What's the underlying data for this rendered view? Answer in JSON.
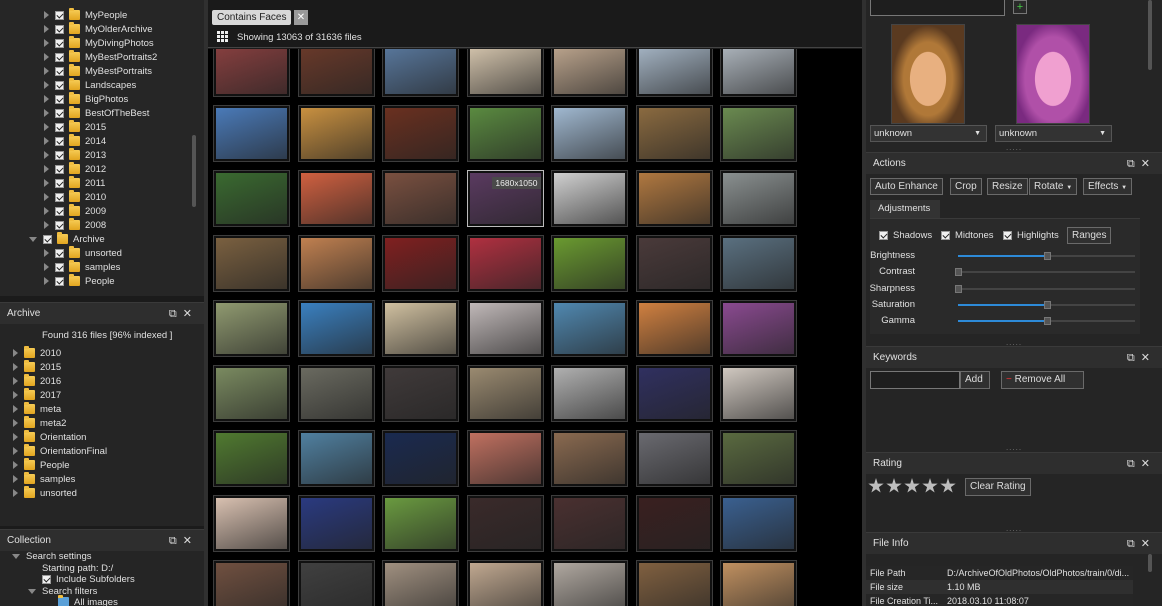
{
  "folders_top": {
    "items": [
      {
        "label": "MyPeople",
        "level": 2,
        "checked": true,
        "expander": "closed"
      },
      {
        "label": "MyOlderArchive",
        "level": 2,
        "checked": true,
        "expander": "closed"
      },
      {
        "label": "MyDivingPhotos",
        "level": 2,
        "checked": true,
        "expander": "closed"
      },
      {
        "label": "MyBestPortraits2",
        "level": 2,
        "checked": true,
        "expander": "closed"
      },
      {
        "label": "MyBestPortraits",
        "level": 2,
        "checked": true,
        "expander": "closed"
      },
      {
        "label": "Landscapes",
        "level": 2,
        "checked": true,
        "expander": "closed"
      },
      {
        "label": "BigPhotos",
        "level": 2,
        "checked": true,
        "expander": "closed"
      },
      {
        "label": "BestOfTheBest",
        "level": 2,
        "checked": true,
        "expander": "closed"
      },
      {
        "label": "2015",
        "level": 2,
        "checked": true,
        "expander": "closed"
      },
      {
        "label": "2014",
        "level": 2,
        "checked": true,
        "expander": "closed"
      },
      {
        "label": "2013",
        "level": 2,
        "checked": true,
        "expander": "closed"
      },
      {
        "label": "2012",
        "level": 2,
        "checked": true,
        "expander": "closed"
      },
      {
        "label": "2011",
        "level": 2,
        "checked": true,
        "expander": "closed"
      },
      {
        "label": "2010",
        "level": 2,
        "checked": true,
        "expander": "closed"
      },
      {
        "label": "2009",
        "level": 2,
        "checked": true,
        "expander": "closed"
      },
      {
        "label": "2008",
        "level": 2,
        "checked": true,
        "expander": "closed"
      },
      {
        "label": "Archive",
        "level": 1,
        "checked": true,
        "expander": "open"
      },
      {
        "label": "unsorted",
        "level": 2,
        "checked": true,
        "expander": "closed"
      },
      {
        "label": "samples",
        "level": 2,
        "checked": true,
        "expander": "closed"
      },
      {
        "label": "People",
        "level": 2,
        "checked": true,
        "expander": "closed"
      }
    ]
  },
  "archive_panel": {
    "title": "Archive",
    "found": "Found 316 files [96% indexed ]",
    "items": [
      "2010",
      "2015",
      "2016",
      "2017",
      "meta",
      "meta2",
      "Orientation",
      "OrientationFinal",
      "People",
      "samples",
      "unsorted"
    ]
  },
  "collection_panel": {
    "title": "Collection",
    "search_settings": "Search settings",
    "starting_path": "Starting path: D:/",
    "include_subfolders": "Include Subfolders",
    "search_filters": "Search filters",
    "all_images": "All images"
  },
  "filter": {
    "chip": "Contains Faces",
    "close": "✕",
    "status": "Showing 13063 of 31636 files"
  },
  "grid": {
    "tooltip": "1680x1050",
    "tooltip_cell": [
      2,
      3
    ],
    "rows": [
      [
        "#8a4040",
        "#6b3a2a",
        "#5a7aa0",
        "#d8c8b0",
        "#c0a890",
        "#a8b8c8",
        "#b0b8c0"
      ],
      [
        "#4a7ab8",
        "#c89040",
        "#6a3020",
        "#5a8a40",
        "#a0b8d0",
        "#8a6a40",
        "#6a8a50"
      ],
      [
        "#3a6a30",
        "#d06040",
        "#7a5040",
        "#5a3a60",
        "#d0d0d0",
        "#b07840",
        "#8a9090"
      ],
      [
        "#7a6040",
        "#c08050",
        "#802020",
        "#b03040",
        "#6a9a30",
        "#4a3a3a",
        "#5a7080"
      ],
      [
        "#909a70",
        "#3a80c0",
        "#d0c0a0",
        "#c0b8b8",
        "#5088b0",
        "#d08040",
        "#8a4a90"
      ],
      [
        "#7a8a60",
        "#6a6a60",
        "#403a3a",
        "#9a8a70",
        "#b0b0b0",
        "#303060",
        "#d0c8c0"
      ],
      [
        "#507a30",
        "#5080a0",
        "#1a2a50",
        "#c07060",
        "#8a6a50",
        "#6a6a70",
        "#5a6a40"
      ],
      [
        "#d8c0b0",
        "#2a3a80",
        "#6a9a40",
        "#3a2a2a",
        "#4a3030",
        "#3a2020",
        "#3a6090"
      ],
      [
        "#705040",
        "#404040",
        "#a09080",
        "#c0a890",
        "#b0a8a0",
        "#806040",
        "#c09060"
      ]
    ]
  },
  "faces": {
    "label1": "unknown",
    "label2": "unknown",
    "color1": "#c08a50",
    "color2": "#c070c0"
  },
  "actions": {
    "title": "Actions",
    "buttons": [
      "Auto Enhance",
      "Crop",
      "Resize",
      "Rotate",
      "Effects"
    ],
    "adjustments_title": "Adjustments",
    "checks": [
      "Shadows",
      "Midtones",
      "Highlights"
    ],
    "ranges": "Ranges",
    "sliders": [
      {
        "label": "Brightness",
        "value": 0.5
      },
      {
        "label": "Contrast",
        "value": 0.0
      },
      {
        "label": "Sharpness",
        "value": 0.0
      },
      {
        "label": "Saturation",
        "value": 0.5
      },
      {
        "label": "Gamma",
        "value": 0.5
      }
    ]
  },
  "keywords": {
    "title": "Keywords",
    "add": "Add",
    "remove_all": "Remove All"
  },
  "rating": {
    "title": "Rating",
    "clear": "Clear Rating"
  },
  "file_info": {
    "title": "File Info",
    "rows": [
      {
        "key": "File Path",
        "value": "D:/ArchiveOfOldPhotos/OldPhotos/train/0/di..."
      },
      {
        "key": "File size",
        "value": "1.10 MB"
      },
      {
        "key": "File Creation Ti...",
        "value": "2018.03.10 11:08:07"
      }
    ]
  },
  "icons": {
    "close": "close-icon",
    "float": "float-icon",
    "add": "add-icon",
    "grid": "grid-view-icon"
  }
}
